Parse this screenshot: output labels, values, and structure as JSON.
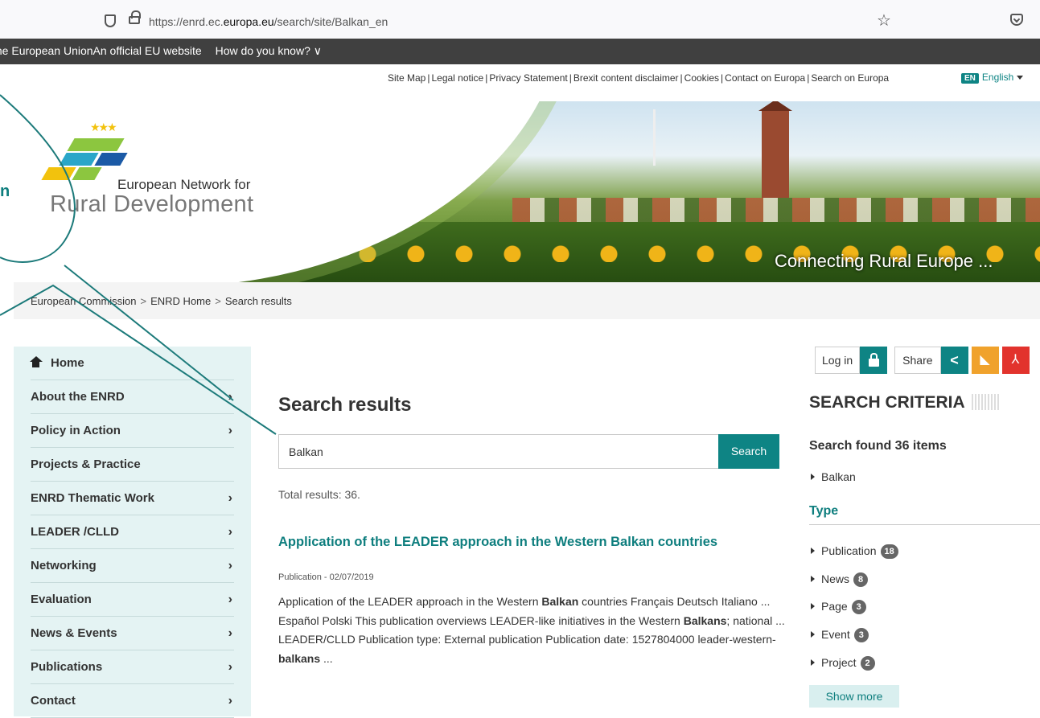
{
  "browser": {
    "url_prefix": "https://enrd.ec.",
    "url_domain": "europa.eu",
    "url_path": "/search/site/Balkan_en"
  },
  "eubar": {
    "text": "the European UnionAn official EU website",
    "how": "How do you know? ∨"
  },
  "utility_links": [
    "Site Map",
    "Legal notice",
    "Privacy Statement",
    "Brexit content disclaimer",
    "Cookies",
    "Contact on Europa",
    "Search on Europa"
  ],
  "language": {
    "code": "EN",
    "label": "English"
  },
  "banner": {
    "brand_line1": "European Network for",
    "brand_line2": "Rural Development",
    "tagline": "Connecting Rural Europe ..."
  },
  "breadcrumb": [
    "European Commission",
    "ENRD Home",
    "Search results"
  ],
  "sidebar": {
    "home": "Home",
    "items": [
      {
        "label": "About the ENRD",
        "has_arrow": true
      },
      {
        "label": "Policy in Action",
        "has_arrow": true
      },
      {
        "label": "Projects & Practice",
        "has_arrow": false
      },
      {
        "label": "ENRD Thematic Work",
        "has_arrow": true
      },
      {
        "label": "LEADER /CLLD",
        "has_arrow": true
      },
      {
        "label": "Networking",
        "has_arrow": true
      },
      {
        "label": "Evaluation",
        "has_arrow": true
      },
      {
        "label": "News & Events",
        "has_arrow": true
      },
      {
        "label": "Publications",
        "has_arrow": true
      },
      {
        "label": "Contact",
        "has_arrow": true
      }
    ]
  },
  "main": {
    "title": "Search results",
    "search_value": "Balkan",
    "search_button": "Search",
    "total": "Total results: 36.",
    "result": {
      "title": "Application of the LEADER approach in the Western Balkan countries",
      "meta": "Publication - 02/07/2019",
      "snippet_parts": [
        {
          "t": "Application of the LEADER approach in the Western ",
          "b": false
        },
        {
          "t": "Balkan",
          "b": true
        },
        {
          "t": " countries Français Deutsch Italiano ... Español Polski This publication overviews LEADER-like initiatives in the Western ",
          "b": false
        },
        {
          "t": "Balkans",
          "b": true
        },
        {
          "t": "; national ... LEADER/CLLD Publication type: External publication Publication date:  1527804000 leader-western-",
          "b": false
        },
        {
          "t": "balkans",
          "b": true
        },
        {
          "t": " ...",
          "b": false
        }
      ]
    }
  },
  "tools": {
    "login": "Log in",
    "share": "Share"
  },
  "criteria": {
    "title": "SEARCH CRITERIA",
    "found": "Search found 36 items",
    "term": "Balkan",
    "type_heading": "Type",
    "types": [
      {
        "label": "Publication",
        "count": "18"
      },
      {
        "label": "News",
        "count": "8"
      },
      {
        "label": "Page",
        "count": "3"
      },
      {
        "label": "Event",
        "count": "3"
      },
      {
        "label": "Project",
        "count": "2"
      }
    ],
    "show_more": "Show more"
  },
  "annotation": {
    "edge_text": "n"
  },
  "colors": {
    "accent": "#0e8484",
    "sidebar_bg": "#e4f3f3",
    "eubar_bg": "#404040"
  }
}
